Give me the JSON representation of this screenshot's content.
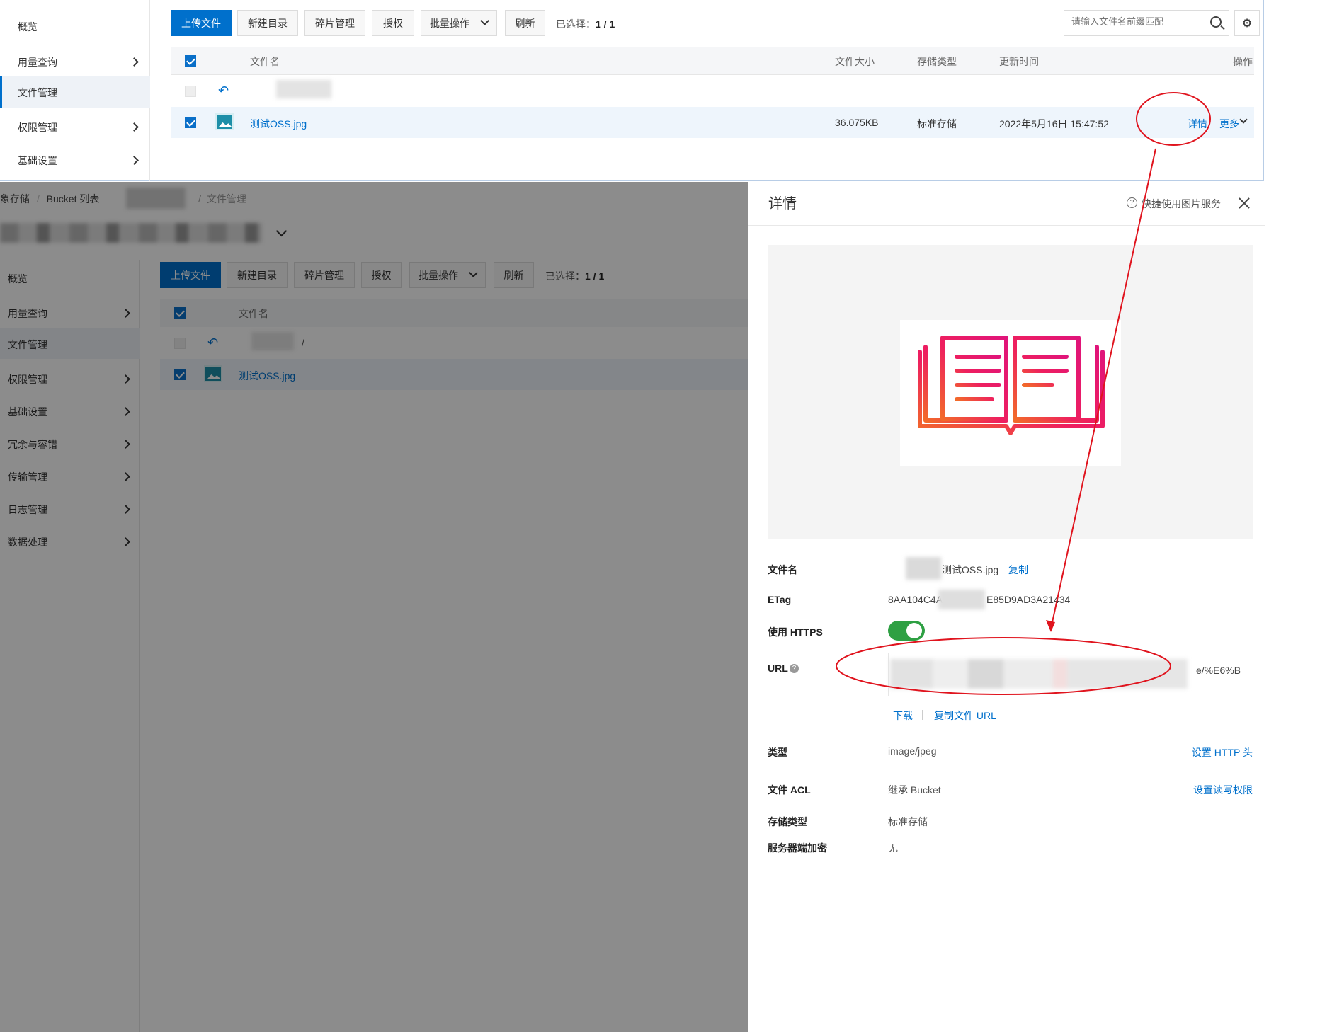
{
  "top": {
    "sidebar": [
      "概览",
      "用量查询",
      "文件管理",
      "权限管理",
      "基础设置"
    ],
    "toolbar": {
      "upload": "上传文件",
      "new_dir": "新建目录",
      "fragments": "碎片管理",
      "authorize": "授权",
      "batch": "批量操作",
      "refresh": "刷新",
      "selected_label": "已选择：",
      "selected_value": "1 / 1",
      "search_placeholder": "请输入文件名前缀匹配"
    },
    "table": {
      "headers": {
        "name": "文件名",
        "size": "文件大小",
        "storage": "存储类型",
        "updated": "更新时间",
        "actions": "操作"
      },
      "row": {
        "name": "测试OSS.jpg",
        "size": "36.075KB",
        "storage": "标准存储",
        "updated": "2022年5月16日 15:47:52",
        "detail": "详情",
        "more": "更多"
      }
    }
  },
  "bg": {
    "breadcrumb": [
      "象存储",
      "Bucket 列表",
      "文件管理"
    ],
    "sidebar": [
      "概览",
      "用量查询",
      "文件管理",
      "权限管理",
      "基础设置",
      "冗余与容错",
      "传输管理",
      "日志管理",
      "数据处理"
    ],
    "toolbar": {
      "upload": "上传文件",
      "new_dir": "新建目录",
      "fragments": "碎片管理",
      "authorize": "授权",
      "batch": "批量操作",
      "refresh": "刷新",
      "selected_label": "已选择：",
      "selected_value": "1 / 1"
    },
    "table": {
      "name_header": "文件名",
      "path_slash": "/",
      "file": "测试OSS.jpg"
    }
  },
  "drawer": {
    "title": "详情",
    "quick_link": "快捷使用图片服务",
    "fields": {
      "filename_label": "文件名",
      "filename_value": "测试OSS.jpg",
      "copy": "复制",
      "etag_label": "ETag",
      "etag_prefix": "8AA104C4A",
      "etag_suffix": "E85D9AD3A21434",
      "https_label": "使用 HTTPS",
      "url_label": "URL",
      "url_tail": "e/%E6%B",
      "download": "下载",
      "copy_url": "复制文件 URL",
      "type_label": "类型",
      "type_value": "image/jpeg",
      "set_http_header": "设置 HTTP 头",
      "acl_label": "文件 ACL",
      "acl_value": "继承 Bucket",
      "set_acl": "设置读写权限",
      "storage_label": "存储类型",
      "storage_value": "标准存储",
      "encryption_label": "服务器端加密",
      "encryption_value": "无"
    },
    "https_enabled": true
  },
  "colors": {
    "primary": "#0070cc",
    "toggle_on": "#2ea043",
    "annotation": "#e0141e",
    "overlay": "#8c8c8c"
  }
}
